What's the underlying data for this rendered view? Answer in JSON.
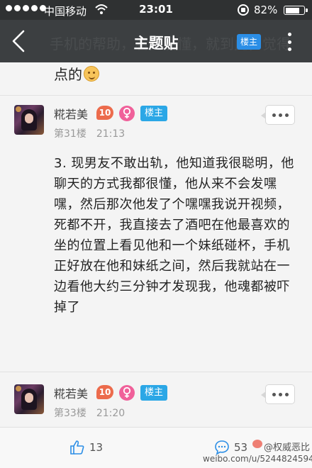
{
  "status_bar": {
    "carrier": "中国移动",
    "time": "23:01",
    "battery_pct": "82%",
    "battery_level": 0.82
  },
  "nav": {
    "title": "主题贴",
    "ghost_text": "手机的帮助，看完看懂，就到此，觉得",
    "owner_button": "楼主",
    "back_icon": "chevron-left-icon",
    "more_icon": "vertical-dots-icon"
  },
  "previous_post": {
    "text": "点的"
  },
  "posts": [
    {
      "username": "糀若美",
      "level": "10",
      "owner_badge": "楼主",
      "floor": "第31楼",
      "time": "21:13",
      "body": "3. 现男友不敢出轨，他知道我很聪明，他聊天的方式我都很懂，他从来不会发嘿嘿，然后那次他发了个嘿嘿我说开视频，死都不开，我直接去了酒吧在他最喜欢的坐的位置上看见他和一个妹纸碰杯，手机正好放在他和妹纸之间，然后我就站在一边看他大约三分钟才发现我，他魂都被吓掉了"
    },
    {
      "username": "糀若美",
      "level": "10",
      "owner_badge": "楼主",
      "floor": "第33楼",
      "time": "21:20"
    }
  ],
  "bottom_bar": {
    "like_count": "13",
    "comment_count": "53"
  },
  "watermark": {
    "name": "@权威恶比",
    "url": "weibo.com/u/5244824594"
  },
  "colors": {
    "nav_bg": "#3c3f41",
    "status_bg": "#2f3132",
    "owner_blue": "#2ba7e6",
    "level_orange": "#ec6b4c",
    "female_pink": "#f0609a"
  }
}
